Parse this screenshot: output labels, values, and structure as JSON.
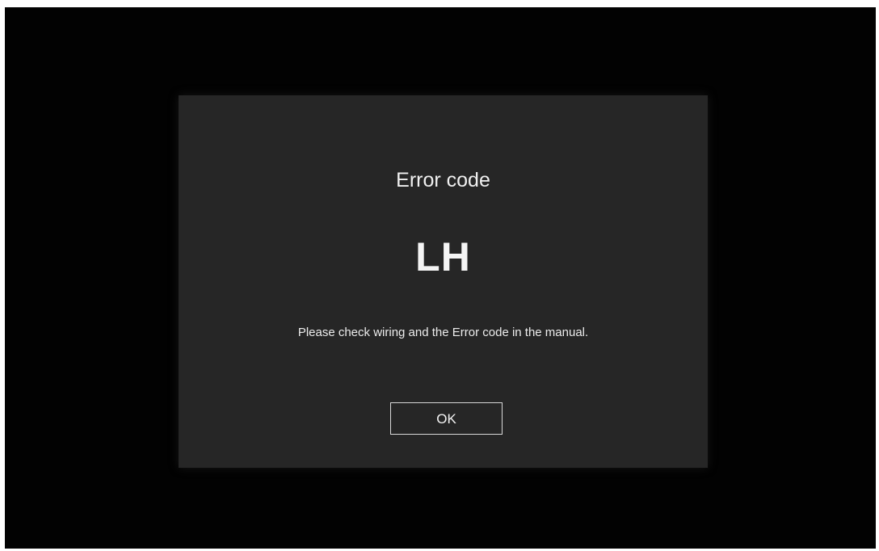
{
  "dialog": {
    "title": "Error code",
    "code": "LH",
    "message": "Please check wiring and the Error code in the manual.",
    "ok_label": "OK"
  },
  "colors": {
    "screen_background": "#020202",
    "dialog_background": "#262626",
    "text": "#f2f2f2",
    "button_border": "#d8d8d8"
  }
}
